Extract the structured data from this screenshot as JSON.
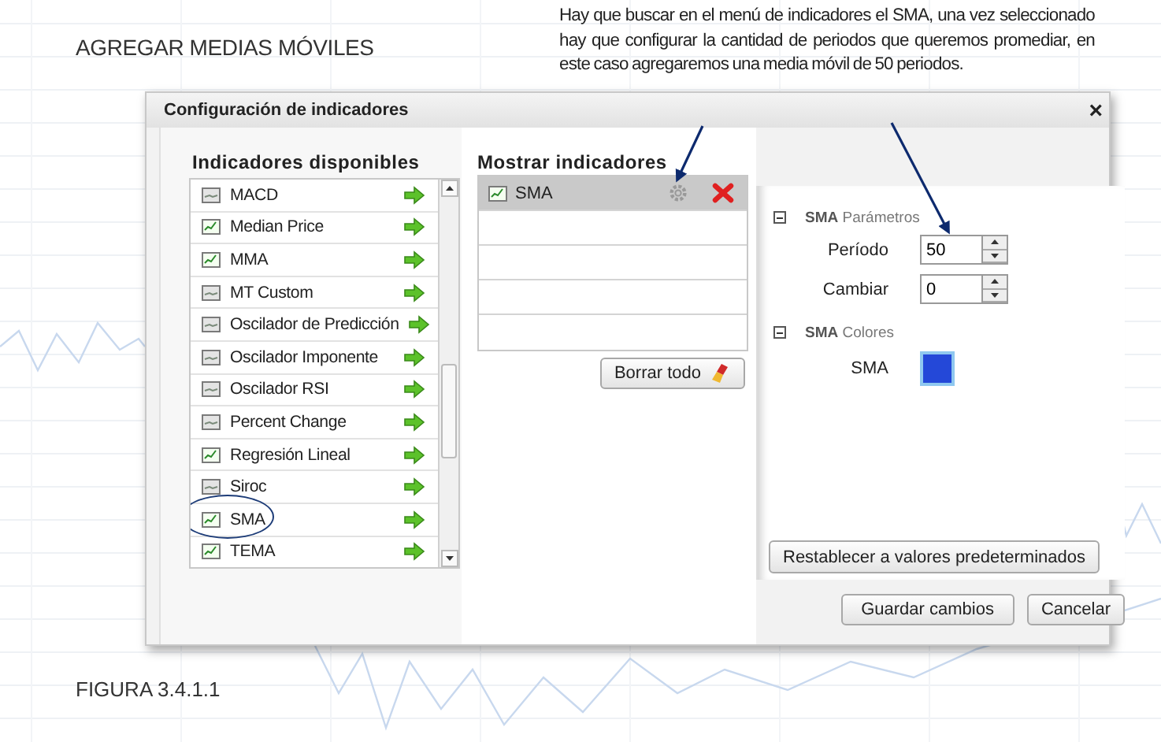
{
  "heading": "AGREGAR MEDIAS MÓVILES",
  "annotation": "Hay que buscar en el menú de indicadores el SMA, una vez seleccionado hay que configurar la cantidad de periodos que queremos promediar, en este caso agregaremos una media móvil de 50 periodos.",
  "dialog": {
    "title": "Configuración de indicadores",
    "close": "×",
    "available": {
      "title": "Indicadores disponibles",
      "items": [
        {
          "label": "MACD",
          "kind": "oscillator",
          "circled": false
        },
        {
          "label": "Median Price",
          "kind": "overlay",
          "circled": false
        },
        {
          "label": "MMA",
          "kind": "overlay",
          "circled": false
        },
        {
          "label": "MT Custom",
          "kind": "oscillator",
          "circled": false
        },
        {
          "label": "Oscilador de Predicción",
          "kind": "oscillator",
          "circled": false
        },
        {
          "label": "Oscilador Imponente",
          "kind": "oscillator",
          "circled": false
        },
        {
          "label": "Oscilador RSI",
          "kind": "oscillator",
          "circled": false
        },
        {
          "label": "Percent Change",
          "kind": "oscillator",
          "circled": false
        },
        {
          "label": "Regresión Lineal",
          "kind": "overlay",
          "circled": false
        },
        {
          "label": "Siroc",
          "kind": "oscillator",
          "circled": false
        },
        {
          "label": "SMA",
          "kind": "overlay",
          "circled": true
        },
        {
          "label": "TEMA",
          "kind": "overlay",
          "circled": false
        }
      ]
    },
    "shown": {
      "title": "Mostrar indicadores",
      "items": [
        {
          "label": "SMA",
          "kind": "overlay",
          "selected": true
        }
      ],
      "clear_button": "Borrar todo"
    },
    "settings": {
      "sections": [
        {
          "name": "SMA",
          "title": "Parámetros",
          "expanded": true,
          "fields": [
            {
              "kind": "spinner",
              "label": "Período",
              "value": "50"
            },
            {
              "kind": "spinner",
              "label": "Cambiar",
              "value": "0"
            }
          ]
        },
        {
          "name": "SMA",
          "title": "Colores",
          "expanded": true,
          "fields": [
            {
              "kind": "color",
              "label": "SMA",
              "color": "#2448d8"
            }
          ]
        }
      ],
      "reset_button": "Restablecer a valores predeterminados"
    },
    "buttons": [
      "Guardar cambios",
      "Cancelar"
    ]
  },
  "caption": "FIGURA 3.4.1.1"
}
